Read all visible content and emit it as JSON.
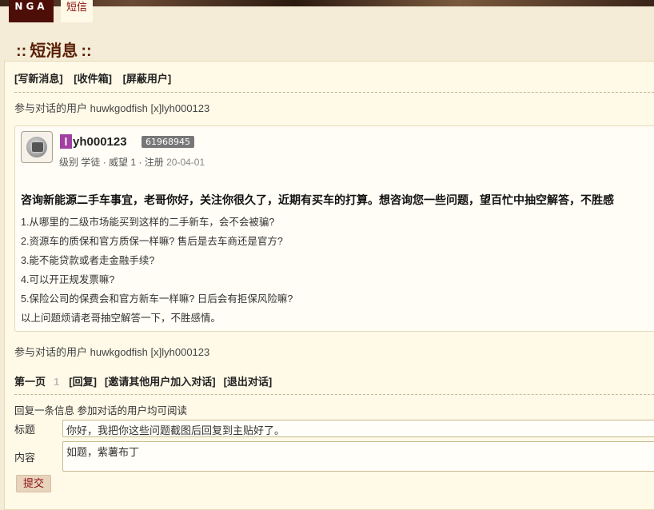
{
  "header": {
    "logo": "NGA",
    "nav_tab": "短信"
  },
  "page": {
    "title_colon_left": "::",
    "title": "短消息",
    "title_colon_right": "::"
  },
  "actions": {
    "compose": "[写新消息]",
    "inbox": "[收件箱]",
    "block": "[屏蔽用户]"
  },
  "participants": {
    "label": "参与对话的用户",
    "users": "huwkgodfish [x]lyh000123"
  },
  "message": {
    "sender": {
      "first_letter": "l",
      "rest": "yh000123",
      "uid": "61968945"
    },
    "meta": {
      "level_label": "级别",
      "level": "学徒",
      "prestige": "威望 1",
      "reg_label": "注册",
      "reg_date": "20-04-01"
    },
    "title": "咨询新能源二手车事宜，老哥你好，关注你很久了，近期有买车的打算。想咨询您一些问题，望百忙中抽空解答，不胜感",
    "lines": [
      "1.从哪里的二级市场能买到这样的二手新车，会不会被骗?",
      "2.资源车的质保和官方质保一样嘛? 售后是去车商还是官方?",
      "3.能不能贷款或者走金融手续?",
      "4.可以开正规发票嘛?",
      "5.保险公司的保费会和官方新车一样嘛? 日后会有拒保风险嘛?",
      "以上问题烦请老哥抽空解答一下，不胜感情。"
    ]
  },
  "pager": {
    "first": "第一页",
    "page": "1",
    "reply": "[回复]",
    "invite": "[邀请其他用户加入对话]",
    "exit": "[退出对话]"
  },
  "reply_form": {
    "label": "回复一条信息 参加对话的用户均可阅读",
    "title_label": "标题",
    "title_value": "你好，我把你这些问题截图后回复到主贴好了。",
    "content_label": "内容",
    "content_value": "如题，紫薯布丁",
    "submit": "提交"
  }
}
